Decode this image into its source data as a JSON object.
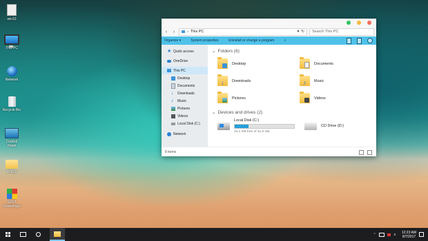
{
  "desktop": {
    "icons": [
      {
        "label": "win10",
        "icon": "document-icon"
      },
      {
        "label": "This PC",
        "icon": "monitor-icon"
      },
      {
        "label": "Network",
        "icon": "globe-icon"
      },
      {
        "label": "Recycle Bin",
        "icon": "recycle-bin-icon"
      },
      {
        "label": "Control Panel",
        "icon": "control-panel-icon"
      },
      {
        "label": "PNGS",
        "icon": "folder-icon"
      },
      {
        "label": "SOFT PowerPack",
        "icon": "package-icon"
      }
    ]
  },
  "window": {
    "address_path": "This PC",
    "search_placeholder": "Search This PC",
    "command_bar": {
      "organize": "Organize ▾",
      "system_properties": "System properties",
      "uninstall": "Uninstall or change a program",
      "more": "»"
    },
    "sidebar": {
      "quick_access": "Quick access",
      "onedrive": "OneDrive",
      "this_pc": "This PC",
      "desktop": "Desktop",
      "documents": "Documents",
      "downloads": "Downloads",
      "music": "Music",
      "pictures": "Pictures",
      "videos": "Videos",
      "local_disk": "Local Disk (C:)",
      "network": "Network"
    },
    "folders_heading": "Folders (6)",
    "folders": {
      "desktop": "Desktop",
      "documents": "Documents",
      "downloads": "Downloads",
      "music": "Music",
      "pictures": "Pictures",
      "videos": "Videos"
    },
    "drives_heading": "Devices and drives (2)",
    "drives": {
      "c_name": "Local Disk (C:)",
      "c_free": "24.1 GB free of 31.5 GB",
      "c_used_fraction": 0.235,
      "d_name": "CD Drive (D:)"
    },
    "status": "8 items"
  },
  "colors": {
    "accent": "#4fc1e9",
    "close_dot": "#f36d5c",
    "min_dot": "#f5b941",
    "max_dot": "#2dc55e",
    "drive_bar": "#26a0da"
  },
  "taskbar": {
    "time": "12:23 AM",
    "date": "9/7/2017"
  }
}
